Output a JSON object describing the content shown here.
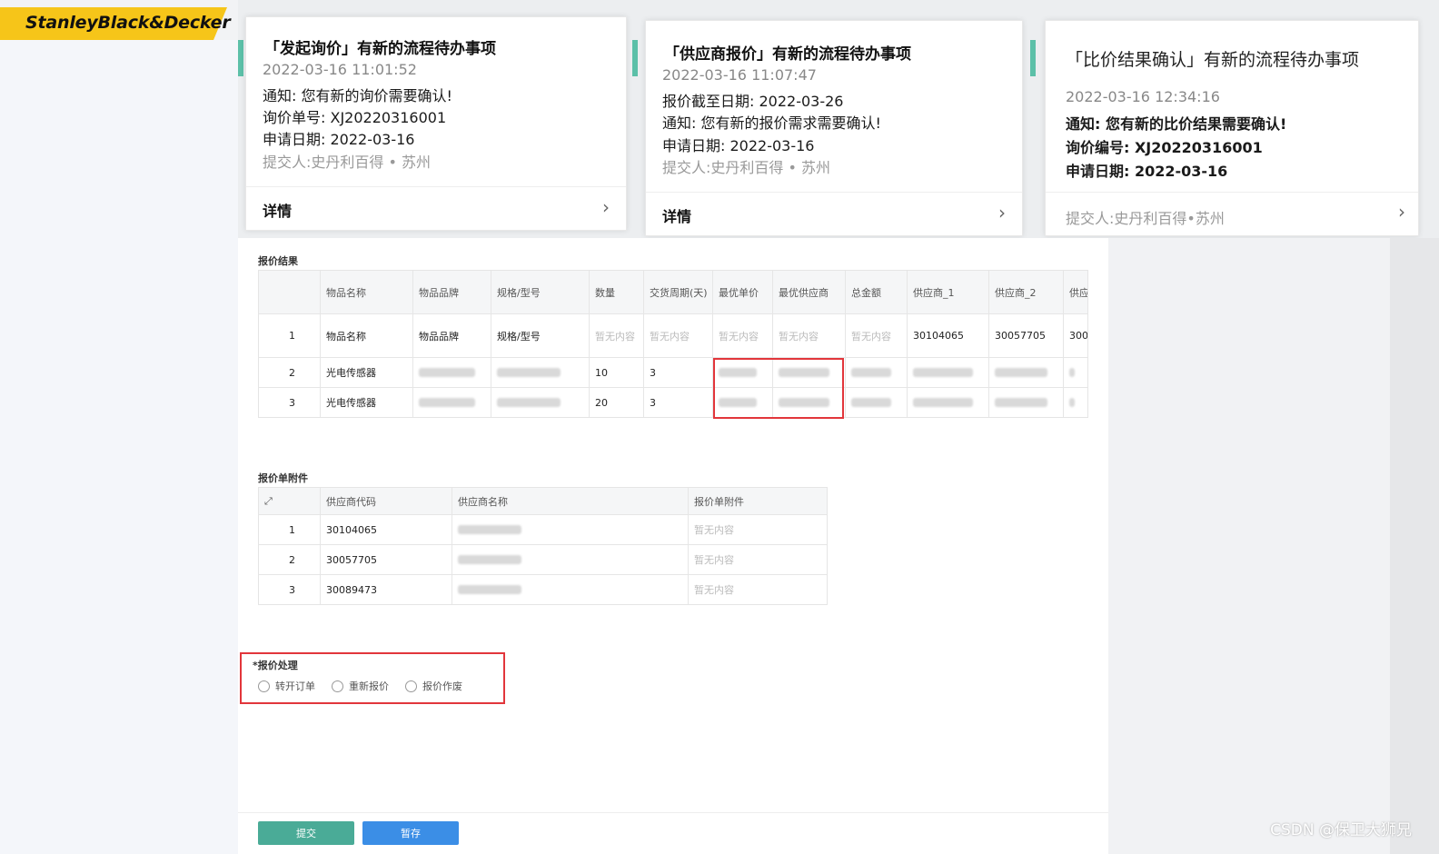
{
  "brand": {
    "logo": "StanleyBlack&Decker",
    "color": "#f6c519"
  },
  "notifications": [
    {
      "title": "「发起询价」有新的流程待办事项",
      "time": "2022-03-16 11:01:52",
      "lines": [
        "通知: 您有新的询价需要确认!",
        "询价单号: XJ20220316001",
        "申请日期: 2022-03-16"
      ],
      "submitter": "提交人:史丹利百得 • 苏州",
      "detail_label": "详情"
    },
    {
      "title": "「供应商报价」有新的流程待办事项",
      "time": "2022-03-16 11:07:47",
      "lines": [
        "报价截至日期: 2022-03-26",
        "通知: 您有新的报价需求需要确认!",
        "申请日期: 2022-03-16"
      ],
      "submitter": "提交人:史丹利百得 • 苏州",
      "detail_label": "详情"
    },
    {
      "title": "「比价结果确认」有新的流程待办事项",
      "time": "2022-03-16 12:34:16",
      "lines": [
        "通知: 您有新的比价结果需要确认!",
        "询价编号: XJ20220316001",
        "申请日期: 2022-03-16"
      ],
      "submitter": "提交人:史丹利百得•苏州"
    }
  ],
  "quote_result": {
    "title": "报价结果",
    "headers": [
      "",
      "物品名称",
      "物品品牌",
      "规格/型号",
      "数量",
      "交货周期(天)",
      "最优单价",
      "最优供应商",
      "总金额",
      "供应商_1",
      "供应商_2",
      "供应"
    ],
    "rows": [
      [
        "1",
        "物品名称",
        "物品品牌",
        "规格/型号",
        "暂无内容",
        "暂无内容",
        "暂无内容",
        "暂无内容",
        "暂无内容",
        "30104065",
        "30057705",
        "300"
      ],
      [
        "2",
        "光电传感器",
        "",
        "",
        "10",
        "3",
        "",
        "",
        "",
        "",
        "",
        ""
      ],
      [
        "3",
        "光电传感器",
        "",
        "",
        "20",
        "3",
        "",
        "",
        "",
        "",
        "",
        ""
      ]
    ]
  },
  "attachments": {
    "title": "报价单附件",
    "headers": [
      "⤢",
      "供应商代码",
      "供应商名称",
      "报价单附件"
    ],
    "rows": [
      [
        "1",
        "30104065",
        "",
        "暂无内容"
      ],
      [
        "2",
        "30057705",
        "",
        "暂无内容"
      ],
      [
        "3",
        "30089473",
        "",
        "暂无内容"
      ]
    ]
  },
  "quote_handling": {
    "label": "*报价处理",
    "options": [
      "转开订单",
      "重新报价",
      "报价作废"
    ]
  },
  "buttons": {
    "submit": "提交",
    "save": "暂存"
  },
  "watermark": "CSDN @保卫大狮兄"
}
